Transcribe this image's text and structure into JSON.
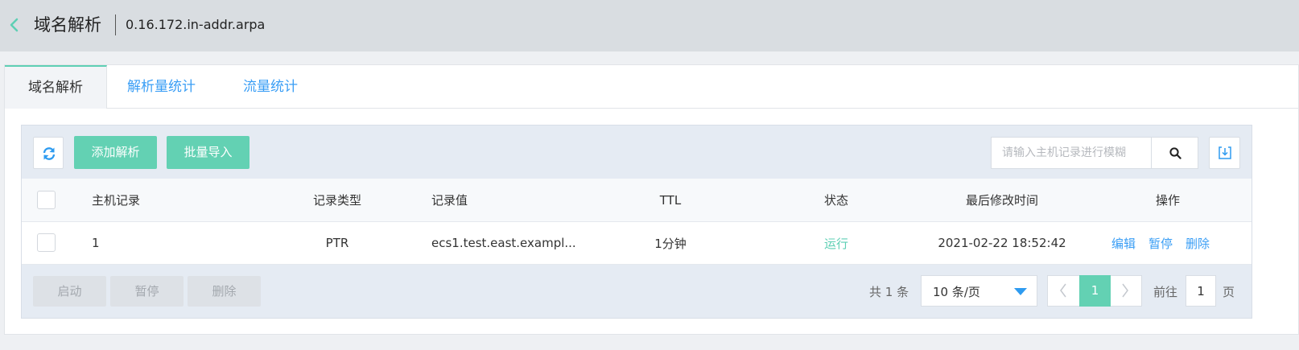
{
  "header": {
    "title": "域名解析",
    "zone": "0.16.172.in-addr.arpa",
    "back_icon": "chevron-left-icon"
  },
  "tabs": [
    {
      "label": "域名解析",
      "active": true
    },
    {
      "label": "解析量统计",
      "active": false
    },
    {
      "label": "流量统计",
      "active": false
    }
  ],
  "toolbar": {
    "refresh_icon": "refresh-icon",
    "add_label": "添加解析",
    "import_label": "批量导入",
    "search_placeholder": "请输入主机记录进行模糊",
    "search_icon": "search-icon",
    "export_icon": "download-icon"
  },
  "table": {
    "columns": [
      "主机记录",
      "记录类型",
      "记录值",
      "TTL",
      "状态",
      "最后修改时间",
      "操作"
    ],
    "rows": [
      {
        "host": "1",
        "type": "PTR",
        "value": "ecs1.test.east.exampl...",
        "ttl": "1分钟",
        "status": "运行",
        "modified": "2021-02-22 18:52:42",
        "actions": [
          "编辑",
          "暂停",
          "删除"
        ]
      }
    ]
  },
  "batch": {
    "start_label": "启动",
    "pause_label": "暂停",
    "delete_label": "删除"
  },
  "pagination": {
    "total_text": "共 1 条",
    "page_size": "10 条/页",
    "current_page": "1",
    "goto_label": "前往",
    "goto_value": "1",
    "goto_unit": "页"
  },
  "colors": {
    "accent_green": "#63d1b3",
    "link_blue": "#3a9ef5",
    "status_green": "#5ecfb4"
  }
}
